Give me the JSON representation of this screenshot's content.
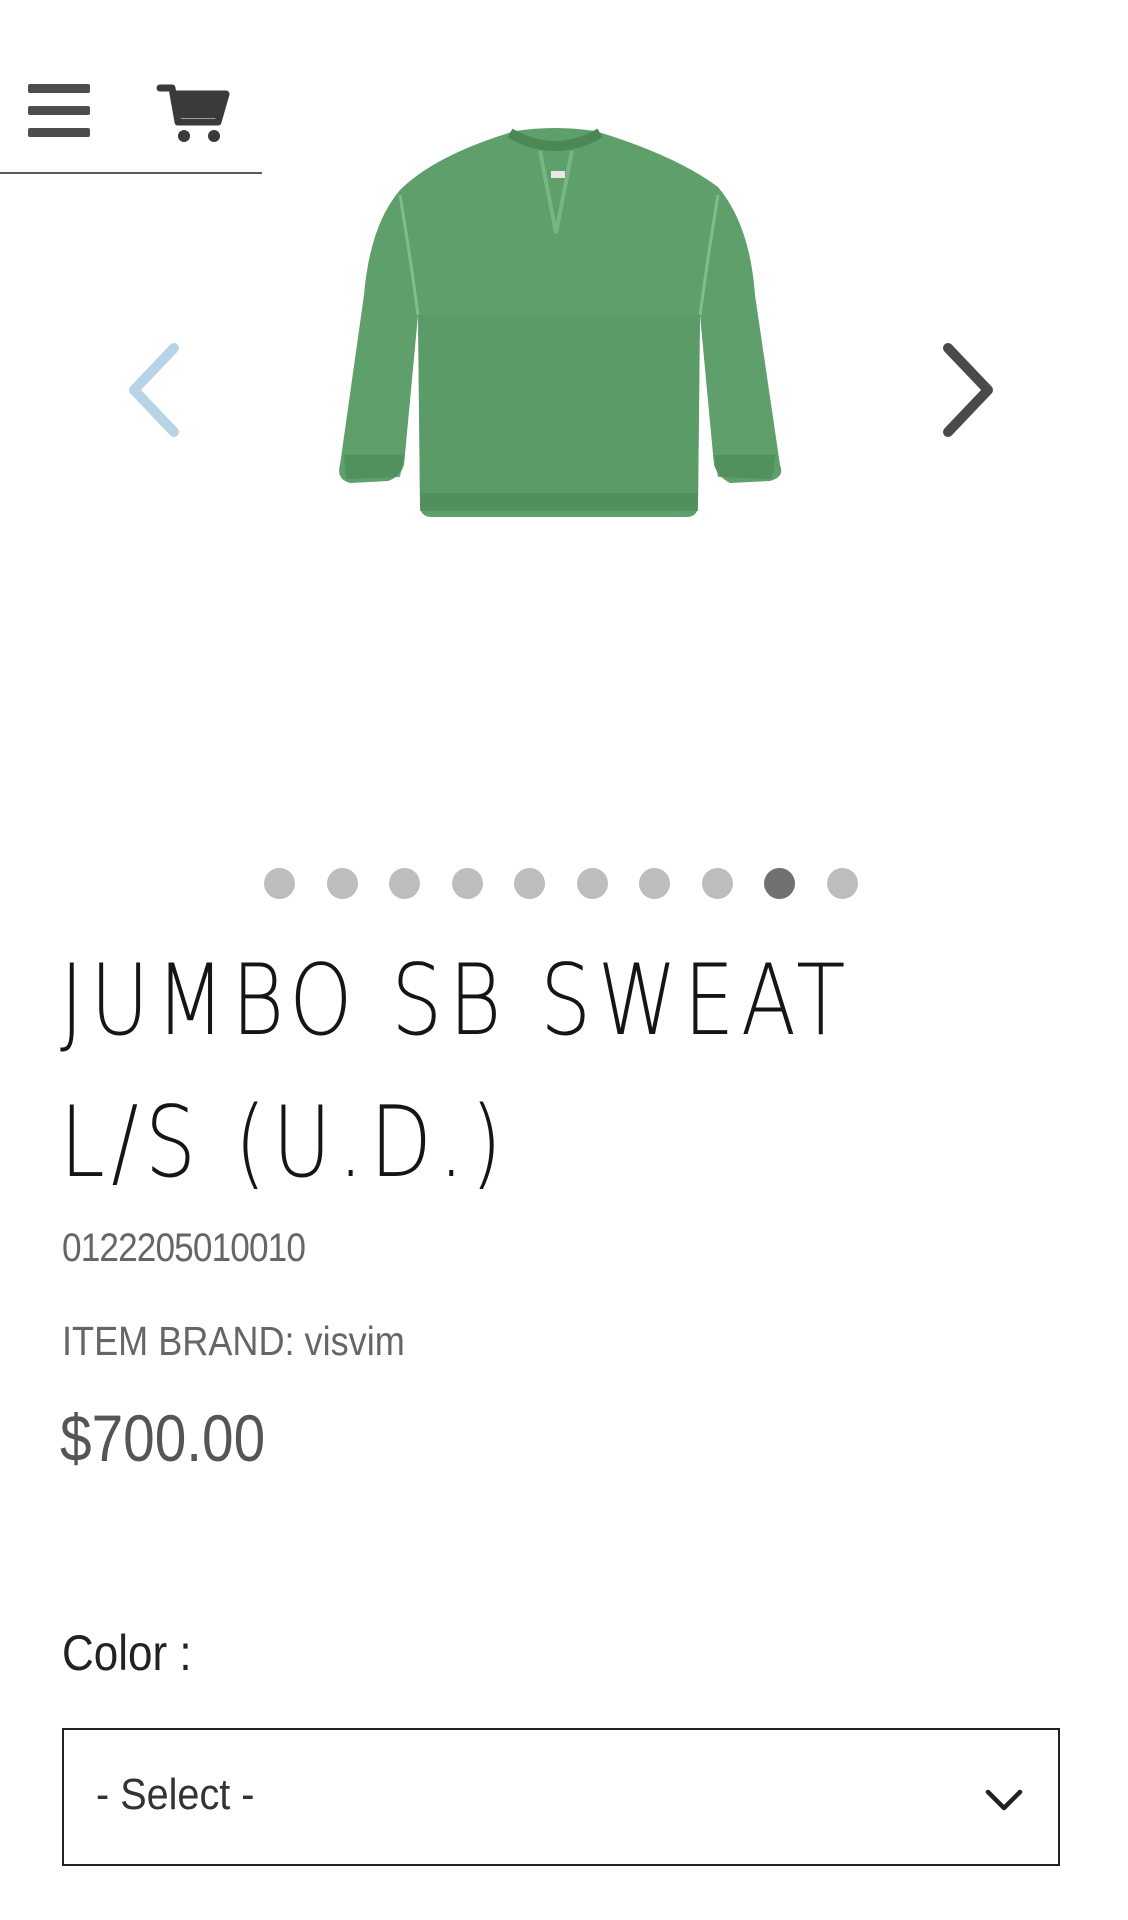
{
  "header": {
    "menu_icon": "hamburger-menu-icon",
    "cart_icon": "shopping-cart-icon"
  },
  "carousel": {
    "prev_icon": "chevron-left-icon",
    "next_icon": "chevron-right-icon",
    "image_subject": "green crewneck sweatshirt",
    "slide_count": 10,
    "active_slide": 9,
    "colors": {
      "prev_arrow": "#b7d3e6",
      "next_arrow": "#4a4a4a",
      "dot": "#bdbdbd",
      "dot_active": "#707070",
      "garment": "#5d9e6a"
    }
  },
  "product": {
    "title_line1": "JUMBO SB SWEAT",
    "title_line2": "L/S (U.D.)",
    "sku": "0122205010010",
    "brand": "ITEM BRAND: visvim",
    "price": "$700.00"
  },
  "options": {
    "color_label": "Color :",
    "color_select_value": "- Select -",
    "select_icon": "chevron-down-icon"
  }
}
